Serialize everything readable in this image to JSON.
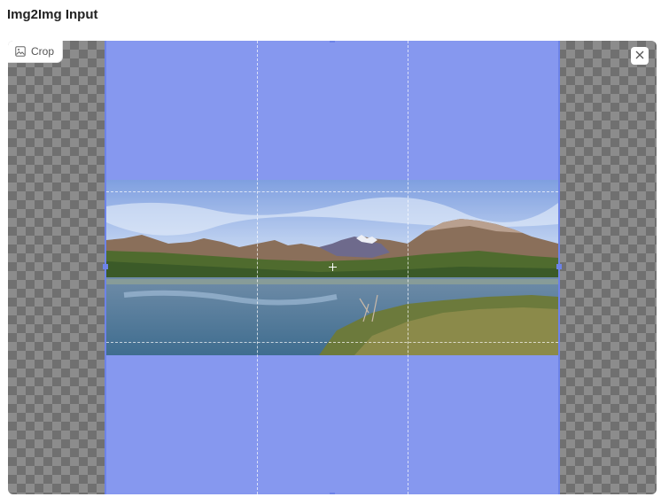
{
  "component": {
    "title": "Img2Img Input"
  },
  "toolbar": {
    "crop_label": "Crop",
    "crop_icon": "image-icon",
    "close_icon": "close-icon"
  },
  "colors": {
    "crop_overlay": "#8698ef",
    "crop_border": "#6d83e8",
    "checker_dark": "#707070",
    "checker_light": "#8c8c8c"
  }
}
